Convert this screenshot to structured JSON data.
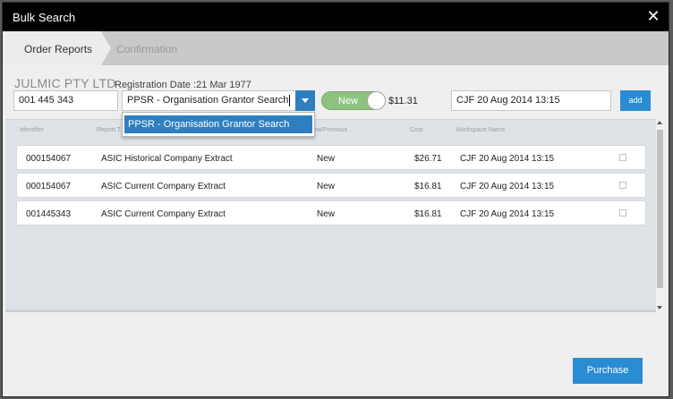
{
  "window": {
    "title": "Bulk Search",
    "close_icon": "close-icon",
    "close_glyph": "✕"
  },
  "steps": [
    {
      "label": "Order Reports",
      "active": true
    },
    {
      "label": "Confirmation",
      "active": false
    }
  ],
  "company": {
    "name": "JULMIC PTY LTD",
    "registration": "Registration Date :21 Mar 1977"
  },
  "form": {
    "identifier": "001 445 343",
    "report_type": "PPSR - Organisation Grantor Search",
    "dropdown_options": [
      "PPSR - Organisation Grantor Search"
    ],
    "toggle_label": "New",
    "cost": "$11.31",
    "workspace": "CJF 20 Aug 2014 13:15",
    "add_label": "add"
  },
  "table": {
    "headers": [
      "Identifier",
      "Report T",
      "New/Previous",
      "Cost",
      "Workspace Name"
    ],
    "rows": [
      {
        "identifier": "000154067",
        "report": "ASIC Historical Company Extract",
        "status": "New",
        "cost": "$26.71",
        "workspace": "CJF 20 Aug 2014 13:15"
      },
      {
        "identifier": "000154067",
        "report": "ASIC Current Company Extract",
        "status": "New",
        "cost": "$16.81",
        "workspace": "CJF 20 Aug 2014 13:15"
      },
      {
        "identifier": "001445343",
        "report": "ASIC Current Company Extract",
        "status": "New",
        "cost": "$16.81",
        "workspace": "CJF 20 Aug 2014 13:15"
      }
    ]
  },
  "footer": {
    "purchase_label": "Purchase"
  },
  "colors": {
    "accent": "#2a8dd3",
    "titlebar": "#000000",
    "toggle_green": "#8ec27f"
  }
}
